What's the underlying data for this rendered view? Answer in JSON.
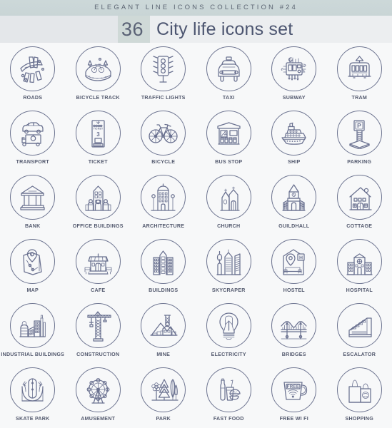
{
  "header": {
    "collection_line": "ELEGANT LINE ICONS COLLECTION #24",
    "count": "36",
    "title": "City life icons set",
    "band_color": "#ccd8d9",
    "accent_color": "#cfd9d7",
    "text_color": "#4c5570"
  },
  "theme": {
    "page_background": "#f7f8f9",
    "icon_stroke": "#6a7190",
    "circle_stroke": "#6d7490",
    "label_color": "#53596e"
  },
  "icons": [
    {
      "id": "roads",
      "label": "ROADS",
      "icon_name": "roads-icon"
    },
    {
      "id": "bicycle-track",
      "label": "BICYCLE TRACK",
      "icon_name": "bicycle-track-icon"
    },
    {
      "id": "traffic-lights",
      "label": "TRAFFIC LIGHTS",
      "icon_name": "traffic-lights-icon"
    },
    {
      "id": "taxi",
      "label": "TAXI",
      "icon_name": "taxi-icon"
    },
    {
      "id": "subway",
      "label": "SUBWAY",
      "icon_name": "subway-icon"
    },
    {
      "id": "tram",
      "label": "TRAM",
      "icon_name": "tram-icon"
    },
    {
      "id": "transport",
      "label": "TRANSPORT",
      "icon_name": "transport-icon"
    },
    {
      "id": "ticket",
      "label": "TICKET",
      "icon_name": "ticket-icon",
      "glyph_text": "TICKET",
      "glyph_number": "3"
    },
    {
      "id": "bicycle",
      "label": "BICYCLE",
      "icon_name": "bicycle-icon"
    },
    {
      "id": "bus-stop",
      "label": "BUS STOP",
      "icon_name": "bus-stop-icon"
    },
    {
      "id": "ship",
      "label": "SHIP",
      "icon_name": "ship-icon"
    },
    {
      "id": "parking",
      "label": "PARKING",
      "icon_name": "parking-icon",
      "glyph_text": "P"
    },
    {
      "id": "bank",
      "label": "BANK",
      "icon_name": "bank-icon"
    },
    {
      "id": "office-buildings",
      "label": "OFFICE BUILDINGS",
      "icon_name": "office-buildings-icon"
    },
    {
      "id": "architecture",
      "label": "ARCHITECTURE",
      "icon_name": "architecture-icon"
    },
    {
      "id": "church",
      "label": "CHURCH",
      "icon_name": "church-icon"
    },
    {
      "id": "guildhall",
      "label": "GUILDHALL",
      "icon_name": "guildhall-icon"
    },
    {
      "id": "cottage",
      "label": "COTTAGE",
      "icon_name": "cottage-icon"
    },
    {
      "id": "map",
      "label": "MAP",
      "icon_name": "map-icon"
    },
    {
      "id": "cafe",
      "label": "CAFE",
      "icon_name": "cafe-icon"
    },
    {
      "id": "buildings",
      "label": "BUILDINGS",
      "icon_name": "buildings-icon"
    },
    {
      "id": "skycraper",
      "label": "SKYCRAPER",
      "icon_name": "skyscraper-icon"
    },
    {
      "id": "hostel",
      "label": "HOSTEL",
      "icon_name": "hostel-icon",
      "glyph_text": "H"
    },
    {
      "id": "hospital",
      "label": "HOSPITAL",
      "icon_name": "hospital-icon"
    },
    {
      "id": "industrial-buildings",
      "label": "INDUSTRIAL BUILDINGS",
      "icon_name": "industrial-buildings-icon"
    },
    {
      "id": "construction",
      "label": "CONSTRUCTION",
      "icon_name": "construction-crane-icon"
    },
    {
      "id": "mine",
      "label": "MINE",
      "icon_name": "mine-icon"
    },
    {
      "id": "electricity",
      "label": "ELECTRICITY",
      "icon_name": "electricity-bulb-icon"
    },
    {
      "id": "bridges",
      "label": "BRIDGES",
      "icon_name": "bridge-icon"
    },
    {
      "id": "escalator",
      "label": "ESCALATOR",
      "icon_name": "escalator-icon"
    },
    {
      "id": "skate-park",
      "label": "SKATE PARK",
      "icon_name": "skate-park-icon"
    },
    {
      "id": "amusement",
      "label": "AMUSEMENT",
      "icon_name": "ferris-wheel-icon"
    },
    {
      "id": "park",
      "label": "PARK",
      "icon_name": "park-trees-icon"
    },
    {
      "id": "fast-food",
      "label": "FAST FOOD",
      "icon_name": "fast-food-icon"
    },
    {
      "id": "free-wi-fi",
      "label": "FREE WI FI",
      "icon_name": "free-wifi-mug-icon",
      "glyph_text": "FREE"
    },
    {
      "id": "shopping",
      "label": "SHOPPING",
      "icon_name": "shopping-bags-icon"
    }
  ]
}
